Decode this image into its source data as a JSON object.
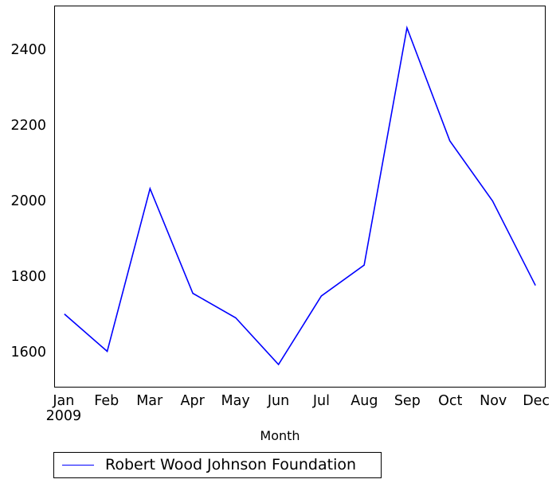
{
  "chart_data": {
    "type": "line",
    "title": "",
    "subtitle": "",
    "xlabel": "Month",
    "ylabel": "",
    "grid": false,
    "legend_position": "below-axes",
    "x_axis_year": "2009",
    "categories": [
      "Jan",
      "Feb",
      "Mar",
      "Apr",
      "May",
      "Jun",
      "Jul",
      "Aug",
      "Sep",
      "Oct",
      "Nov",
      "Dec"
    ],
    "xtick_labels": [
      "Jan",
      "Feb",
      "Mar",
      "Apr",
      "May",
      "Jun",
      "Jul",
      "Aug",
      "Sep",
      "Oct",
      "Nov",
      "Dec"
    ],
    "ytick_labels": [
      "1600",
      "1800",
      "2000",
      "2200",
      "2400"
    ],
    "yticks": [
      1600,
      1800,
      2000,
      2200,
      2400
    ],
    "ylim": [
      1509,
      2519
    ],
    "xlim": [
      -0.22,
      11.22
    ],
    "series": [
      {
        "name": "Robert Wood Johnson Foundation",
        "color": "#0000ff",
        "values": [
          1702,
          1603,
          2035,
          1757,
          1692,
          1568,
          1750,
          1832,
          2462,
          2162,
          2002,
          1778
        ]
      }
    ]
  },
  "legend": {
    "entries": [
      {
        "label": "Robert Wood Johnson Foundation",
        "color": "#0000ff"
      }
    ]
  },
  "axes": {
    "x_title": "Month",
    "x_year_suffix": "2009"
  },
  "colors": {
    "line": "#0000ff",
    "axis": "#000000",
    "background": "#ffffff"
  }
}
